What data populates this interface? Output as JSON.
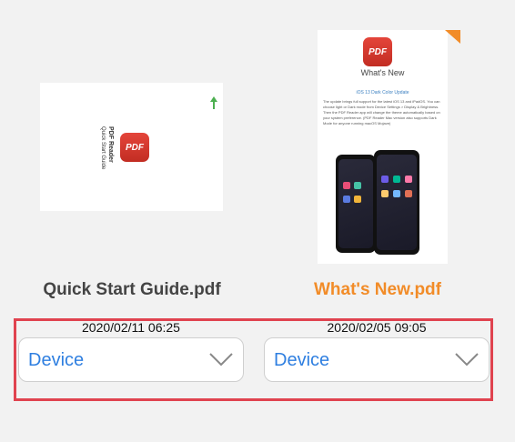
{
  "files": [
    {
      "name": "Quick Start Guide.pdf",
      "timestamp": "2020/02/11 06:25",
      "location": "Device",
      "thumbnail": {
        "badge": "PDF",
        "title": "PDF Reader",
        "subtitle": "Quick Start Guide"
      }
    },
    {
      "name": "What's New.pdf",
      "timestamp": "2020/02/05 09:05",
      "location": "Device",
      "thumbnail": {
        "badge": "PDF",
        "title": "What's New",
        "subtitle": "iOS 13 Dark Color Update",
        "body": "The update brings full support for the latest iOS 13 and iPadOS. You can choose light or Dark mode from Device Settings > Display & Brightness. Then the PDF Reader app will change the theme automatically based on your system preference. (PDF Reader Mac version also supports Dark Mode for anyone running macOS Mojave)"
      },
      "name_color": "#f28c28",
      "unread_marker_color": "#f28c28"
    }
  ],
  "accent_color": "#2f7fe0",
  "highlight_color": "#e0434f"
}
